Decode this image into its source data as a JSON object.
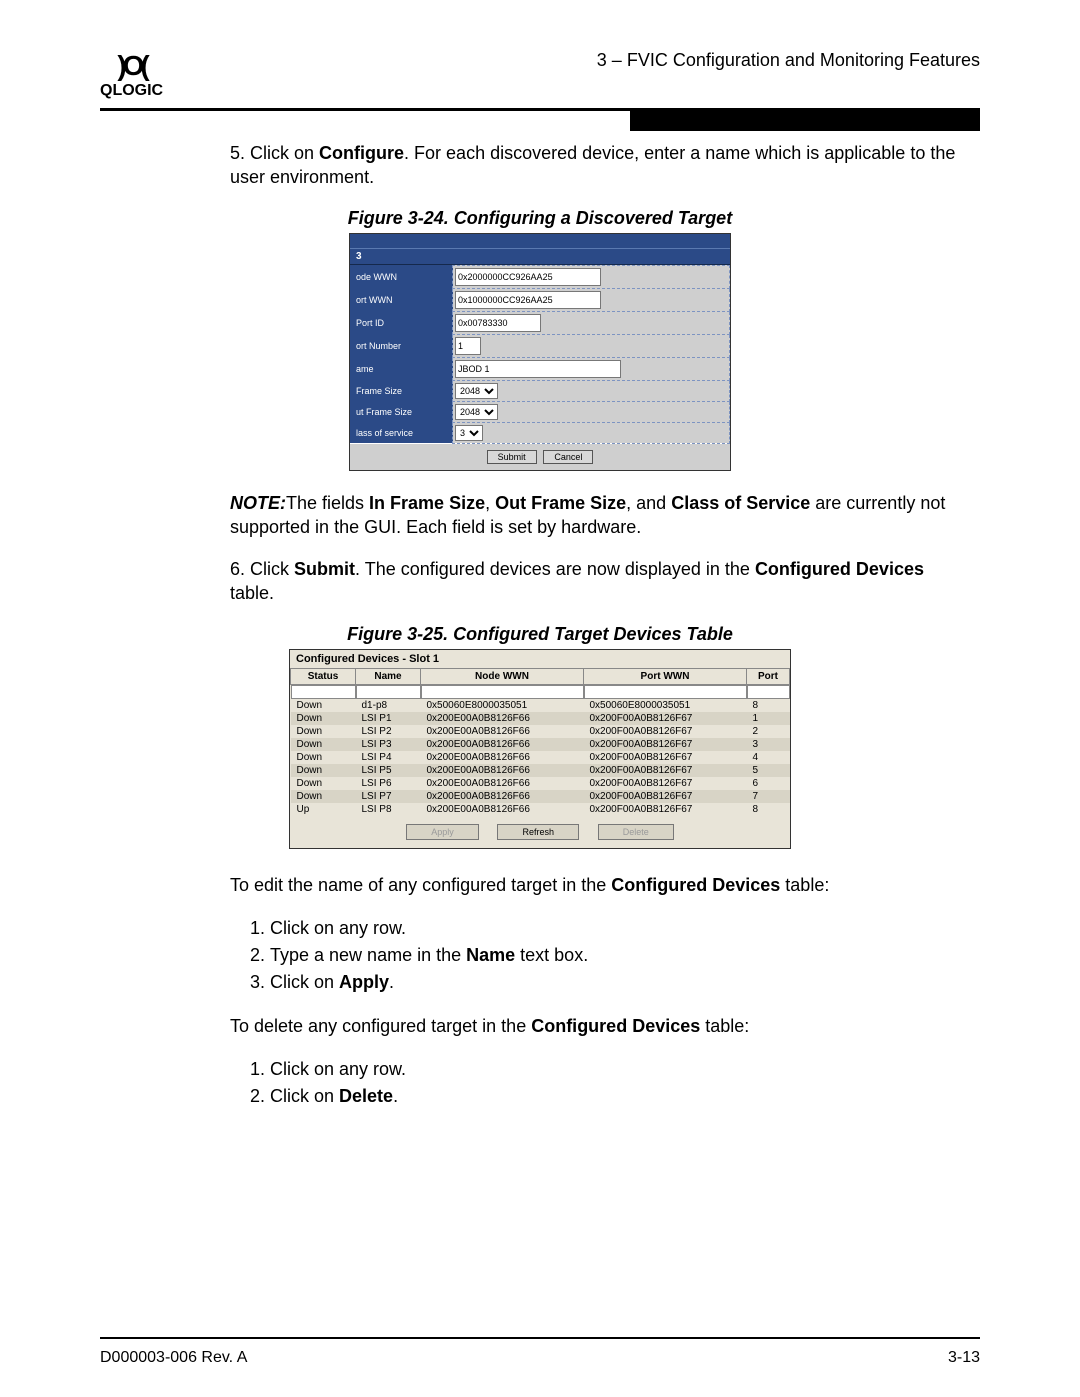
{
  "header": {
    "logo_text": "QLOGIC",
    "right": "3 – FVIC Configuration and Monitoring Features"
  },
  "step5": {
    "prefix": "5.  Click on ",
    "bold1": "Configure",
    "rest": ". For each discovered device, enter a name which is applicable to the user environment."
  },
  "fig24": {
    "caption": "Figure 3-24. Configuring a Discovered Target",
    "three": "3",
    "rows": {
      "node_wwn_label": "ode WWN",
      "node_wwn_val": "0x2000000CC926AA25",
      "port_wwn_label": "ort WWN",
      "port_wwn_val": "0x1000000CC926AA25",
      "port_id_label": "Port ID",
      "port_id_val": "0x00783330",
      "port_num_label": "ort Number",
      "port_num_val": "1",
      "name_label": "ame",
      "name_val": "JBOD 1",
      "frame_label": "Frame Size",
      "frame_val": "2048",
      "out_frame_label": "ut Frame Size",
      "out_frame_val": "2048",
      "cos_label": "lass of service",
      "cos_val": "3"
    },
    "submit": "Submit",
    "cancel": "Cancel"
  },
  "note": {
    "lead": "NOTE:",
    "t1": "The fields ",
    "b1": "In Frame Size",
    "t2": ", ",
    "b2": "Out Frame Size",
    "t3": ", and ",
    "b3": "Class of Service",
    "t4": " are currently not supported in the GUI. Each field is set by hardware."
  },
  "step6": {
    "prefix": "6.  Click ",
    "bold1": "Submit",
    "mid": ". The configured devices are now displayed in the ",
    "bold2": "Configured Devices",
    "suffix": " table."
  },
  "fig25": {
    "caption": "Figure 3-25. Configured Target Devices Table",
    "title": "Configured Devices - Slot 1",
    "headers": [
      "Status",
      "Name",
      "Node WWN",
      "Port WWN",
      "Port"
    ],
    "rows": [
      {
        "status": "Down",
        "name": "d1-p8",
        "node": "0x50060E8000035051",
        "port": "0x50060E8000035051",
        "pnum": "8"
      },
      {
        "status": "Down",
        "name": "LSI P1",
        "node": "0x200E00A0B8126F66",
        "port": "0x200F00A0B8126F67",
        "pnum": "1"
      },
      {
        "status": "Down",
        "name": "LSI P2",
        "node": "0x200E00A0B8126F66",
        "port": "0x200F00A0B8126F67",
        "pnum": "2"
      },
      {
        "status": "Down",
        "name": "LSI P3",
        "node": "0x200E00A0B8126F66",
        "port": "0x200F00A0B8126F67",
        "pnum": "3"
      },
      {
        "status": "Down",
        "name": "LSI P4",
        "node": "0x200E00A0B8126F66",
        "port": "0x200F00A0B8126F67",
        "pnum": "4"
      },
      {
        "status": "Down",
        "name": "LSI P5",
        "node": "0x200E00A0B8126F66",
        "port": "0x200F00A0B8126F67",
        "pnum": "5"
      },
      {
        "status": "Down",
        "name": "LSI P6",
        "node": "0x200E00A0B8126F66",
        "port": "0x200F00A0B8126F67",
        "pnum": "6"
      },
      {
        "status": "Down",
        "name": "LSI P7",
        "node": "0x200E00A0B8126F66",
        "port": "0x200F00A0B8126F67",
        "pnum": "7"
      },
      {
        "status": "Up",
        "name": "LSI P8",
        "node": "0x200E00A0B8126F66",
        "port": "0x200F00A0B8126F67",
        "pnum": "8"
      }
    ],
    "apply": "Apply",
    "refresh": "Refresh",
    "delete": "Delete"
  },
  "edit_para": {
    "t1": "To edit the name of any configured target in the ",
    "b1": "Configured Devices",
    "t2": " table:"
  },
  "edit_steps": {
    "s1": "Click on any row.",
    "s2a": "Type a new name in the ",
    "s2b": "Name",
    "s2c": " text box.",
    "s3a": "Click on ",
    "s3b": "Apply",
    "s3c": "."
  },
  "delete_para": {
    "t1": "To delete any configured target in the ",
    "b1": "Configured Devices",
    "t2": " table:"
  },
  "delete_steps": {
    "s1": "Click on any row.",
    "s2a": "Click on ",
    "s2b": "Delete",
    "s2c": "."
  },
  "footer": {
    "left": "D000003-006 Rev. A",
    "right": "3-13"
  }
}
